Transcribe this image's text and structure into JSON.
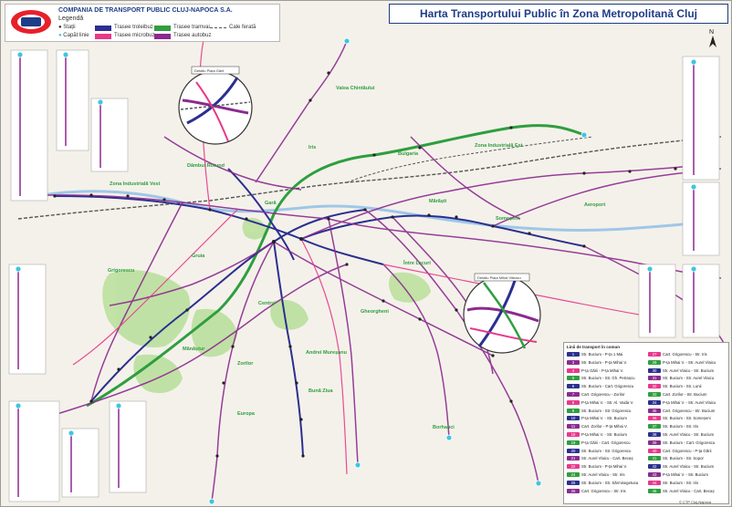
{
  "header": {
    "company": "COMPANIA DE TRANSPORT PUBLIC CLUJ-NAPOCA S.A.",
    "legend_title": "Legendă",
    "map_title": "Harta Transportului Public în Zona Metropolitană Cluj"
  },
  "legend": {
    "stations": "Stații",
    "terminals": "Capăt linie",
    "trolleybus": "Trasee troleibuz",
    "microbus": "Trasee microbuz",
    "tram": "Trasee tramvai",
    "bus": "Trasee autobuz",
    "railway": "Cale ferată"
  },
  "colors": {
    "trolleybus": "#2b2f8f",
    "microbus": "#e8388a",
    "tram": "#2e9e3f",
    "bus": "#8b2a8f",
    "railway": "#555555",
    "park": "#b8df9a",
    "water": "#9fc7e8",
    "title": "#1f3c88"
  },
  "districts": [
    {
      "name": "Dâmbul Rotund",
      "color": "#2e9e3f"
    },
    {
      "name": "Zona Industrială Vest",
      "color": "#2e9e3f"
    },
    {
      "name": "Gară",
      "color": "#2e9e3f"
    },
    {
      "name": "Iris",
      "color": "#2e9e3f"
    },
    {
      "name": "Bulgaria",
      "color": "#2e9e3f"
    },
    {
      "name": "Zona Industrială Est",
      "color": "#2e9e3f"
    },
    {
      "name": "Mărăști",
      "color": "#2e9e3f"
    },
    {
      "name": "Someșeni",
      "color": "#2e9e3f"
    },
    {
      "name": "Aeroport",
      "color": "#2e9e3f"
    },
    {
      "name": "Grigorescu",
      "color": "#2e9e3f"
    },
    {
      "name": "Gruia",
      "color": "#2e9e3f"
    },
    {
      "name": "Centru",
      "color": "#2e9e3f"
    },
    {
      "name": "Gheorgheni",
      "color": "#2e9e3f"
    },
    {
      "name": "Între Lacuri",
      "color": "#2e9e3f"
    },
    {
      "name": "Mănăștur",
      "color": "#2e9e3f"
    },
    {
      "name": "Zorilor",
      "color": "#2e9e3f"
    },
    {
      "name": "Andrei Mureșanu",
      "color": "#2e9e3f"
    },
    {
      "name": "Bună Ziua",
      "color": "#2e9e3f"
    },
    {
      "name": "Europa",
      "color": "#2e9e3f"
    },
    {
      "name": "Borhanci",
      "color": "#2e9e3f"
    },
    {
      "name": "Valea Chintăului",
      "color": "#2e9e3f"
    }
  ],
  "insets": {
    "piata_garii": "Detaliu Piața Gării",
    "piata_mihai": "Detaliu Piața Mihai Viteazu"
  },
  "table": {
    "head": "Linii de transport în comun",
    "rows": [
      {
        "line": "1",
        "route": "Str. Bucium - P-ța 1 Mai"
      },
      {
        "line": "3",
        "route": "Str. Bucium - P-ța Mihai V."
      },
      {
        "line": "4",
        "route": "P-ța Gării - P-ța Mihai V."
      },
      {
        "line": "5",
        "route": "Str. Bucium - Str. Gh. Petrașcu"
      },
      {
        "line": "6",
        "route": "Str. Bucium - Cart. Grigorescu"
      },
      {
        "line": "7",
        "route": "Cart. Grigorescu - Zorilor"
      },
      {
        "line": "8",
        "route": "P-ța Mihai V. - Str. Al. Vaida V."
      },
      {
        "line": "9",
        "route": "Str. Bucium - Str. Grigorescu"
      },
      {
        "line": "10",
        "route": "P-ța Mihai V. - Str. Bucium"
      },
      {
        "line": "11",
        "route": "Cart. Zorilor - P-ța Mihai V."
      },
      {
        "line": "18",
        "route": "P-ța Mihai V. - Str. Bucium"
      },
      {
        "line": "19",
        "route": "P-ța Gării - Cart. Grigorescu"
      },
      {
        "line": "20",
        "route": "Str. Bucium - Str. Grigorescu"
      },
      {
        "line": "21",
        "route": "Str. Aurel Vlaicu - Cart. Becaș"
      },
      {
        "line": "22",
        "route": "Str. Bucium - P-ța Mihai V."
      },
      {
        "line": "24",
        "route": "Str. Aurel Vlaicu - Str. Iris"
      },
      {
        "line": "25",
        "route": "Str. Bucium - Str. Sărmisegetusa"
      },
      {
        "line": "26",
        "route": "Cart. Grigorescu - Str. Iris"
      },
      {
        "line": "27",
        "route": "Cart. Grigorescu - Str. Iris"
      },
      {
        "line": "29",
        "route": "P-ța Mihai V. - Str. Aurel Vlaicu"
      },
      {
        "line": "30",
        "route": "Str. Aurel Vlaicu - Str. Bucium"
      },
      {
        "line": "31",
        "route": "Str. Bucium - Str. Aurel Vlaicu"
      },
      {
        "line": "32",
        "route": "Str. Bucium - Str. Lunii"
      },
      {
        "line": "33",
        "route": "Cart. Zorilor - Str. Bucium"
      },
      {
        "line": "34",
        "route": "P-ța Mihai V. - Str. Aurel Vlaicu"
      },
      {
        "line": "35",
        "route": "Cart. Grigorescu - Str. Bucium"
      },
      {
        "line": "36",
        "route": "Str. Bucium - Str. Someșeni"
      },
      {
        "line": "37",
        "route": "Str. Bucium - Str. Iris"
      },
      {
        "line": "38",
        "route": "Str. Aurel Vlaicu - Str. Bucium"
      },
      {
        "line": "39",
        "route": "Str. Bucium - Cart. Grigorescu"
      },
      {
        "line": "40",
        "route": "Cart. Grigorescu - P-ța Gării"
      },
      {
        "line": "41",
        "route": "Str. Bucium - Str. Sopor"
      },
      {
        "line": "42",
        "route": "Str. Aurel Vlaicu - Str. Bucium"
      },
      {
        "line": "43",
        "route": "P-ța Mihai V. - Str. Bucium"
      },
      {
        "line": "44",
        "route": "Str. Bucium - Str. Iris"
      },
      {
        "line": "45",
        "route": "Str. Aurel Vlaicu - Cart. Becaș"
      }
    ]
  },
  "credit": "© CTP Cluj-Napoca"
}
